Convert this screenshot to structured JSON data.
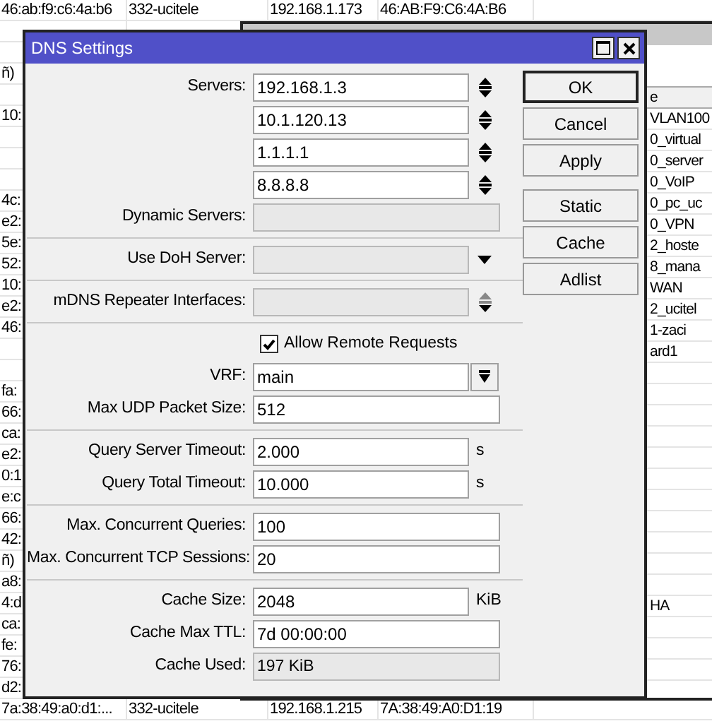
{
  "background_table": {
    "rows": [
      {
        "column_1": "46:ab:f9:c6:4a:b6",
        "column_2": "332-ucitele",
        "column_3": "192.168.1.173",
        "column_4": "46:AB:F9:C6:4A:B6"
      },
      {},
      {},
      {
        "column_1": "ñ)"
      },
      {},
      {
        "column_1": "10:"
      },
      {},
      {},
      {},
      {
        "column_1": "4c:"
      },
      {
        "column_1": "e2:"
      },
      {
        "column_1": "5e:"
      },
      {
        "column_1": "52:"
      },
      {
        "column_1": "10:"
      },
      {
        "column_1": "e2:"
      },
      {
        "column_1": "46:"
      },
      {},
      {},
      {
        "column_1": "fa:"
      },
      {
        "column_1": "66:"
      },
      {
        "column_1": "ca:"
      },
      {
        "column_1": "e2:"
      },
      {
        "column_1": "0:1"
      },
      {
        "column_1": "e:c"
      },
      {
        "column_1": "66:"
      },
      {
        "column_1": "42:"
      },
      {
        "column_1": "ñ)"
      },
      {
        "column_1": "a8:"
      },
      {
        "column_1": "4:d"
      },
      {
        "column_1": "ca:"
      },
      {
        "column_1": "fe:"
      },
      {
        "column_1": "76:"
      },
      {
        "column_1": "d2:"
      },
      {
        "column_1": "7a:38:49:a0:d1:...",
        "column_2": "332-ucitele",
        "column_3": "192.168.1.215",
        "column_4": "7A:38:49:A0:D1:19"
      }
    ]
  },
  "address_list_window": {
    "header": "e",
    "rows": [
      {
        "text": "VLAN100"
      },
      {
        "text": "0_virtual"
      },
      {
        "text": "0_server"
      },
      {
        "text": "0_VoIP"
      },
      {
        "text": "0_pc_uc"
      },
      {
        "text": "0_VPN"
      },
      {
        "text": "2_hoste"
      },
      {
        "text": "8_mana"
      },
      {
        "text": "WAN"
      },
      {
        "text": "2_ucitel"
      },
      {
        "text": "1-zaci"
      },
      {
        "text": "ard1"
      },
      {},
      {},
      {},
      {},
      {},
      {},
      {},
      {},
      {},
      {},
      {},
      {
        "text": "HA"
      },
      {},
      {},
      {},
      {}
    ]
  },
  "dialog": {
    "title": "DNS Settings",
    "groups": [
      [
        {
          "kind": "spin",
          "label": "Servers:",
          "value": "192.168.1.3"
        },
        {
          "kind": "spin",
          "value": "10.1.120.13"
        },
        {
          "kind": "spin",
          "value": "1.1.1.1"
        },
        {
          "kind": "spin",
          "value": "8.8.8.8"
        },
        {
          "kind": "readonly",
          "label": "Dynamic Servers:"
        }
      ],
      [
        {
          "kind": "dropdown",
          "label": "Use DoH Server:"
        }
      ],
      [
        {
          "kind": "multi",
          "label": "mDNS Repeater Interfaces:"
        }
      ],
      [
        {
          "kind": "checkbox",
          "label": "Allow Remote Requests",
          "checked": true
        },
        {
          "kind": "select",
          "label": "VRF:",
          "value": "main"
        },
        {
          "kind": "text",
          "label": "Max UDP Packet Size:",
          "value": "512"
        }
      ],
      [
        {
          "kind": "text",
          "label": "Query Server Timeout:",
          "value": "2.000",
          "unit": "s"
        },
        {
          "kind": "text",
          "label": "Query Total Timeout:",
          "value": "10.000",
          "unit": "s"
        }
      ],
      [
        {
          "kind": "text",
          "label": "Max. Concurrent Queries:",
          "value": "100"
        },
        {
          "kind": "text",
          "label": "Max. Concurrent TCP Sessions:",
          "value": "20"
        }
      ],
      [
        {
          "kind": "text",
          "label": "Cache Size:",
          "value": "2048",
          "unit": "KiB"
        },
        {
          "kind": "text",
          "label": "Cache Max TTL:",
          "value": "7d 00:00:00"
        },
        {
          "kind": "readonly",
          "label": "Cache Used:",
          "value": "197 KiB"
        }
      ]
    ],
    "button_groups": [
      [
        {
          "label": "OK",
          "default": true
        },
        {
          "label": "Cancel"
        },
        {
          "label": "Apply"
        }
      ],
      [
        {
          "label": "Static"
        },
        {
          "label": "Cache"
        },
        {
          "label": "Adlist"
        }
      ]
    ]
  }
}
